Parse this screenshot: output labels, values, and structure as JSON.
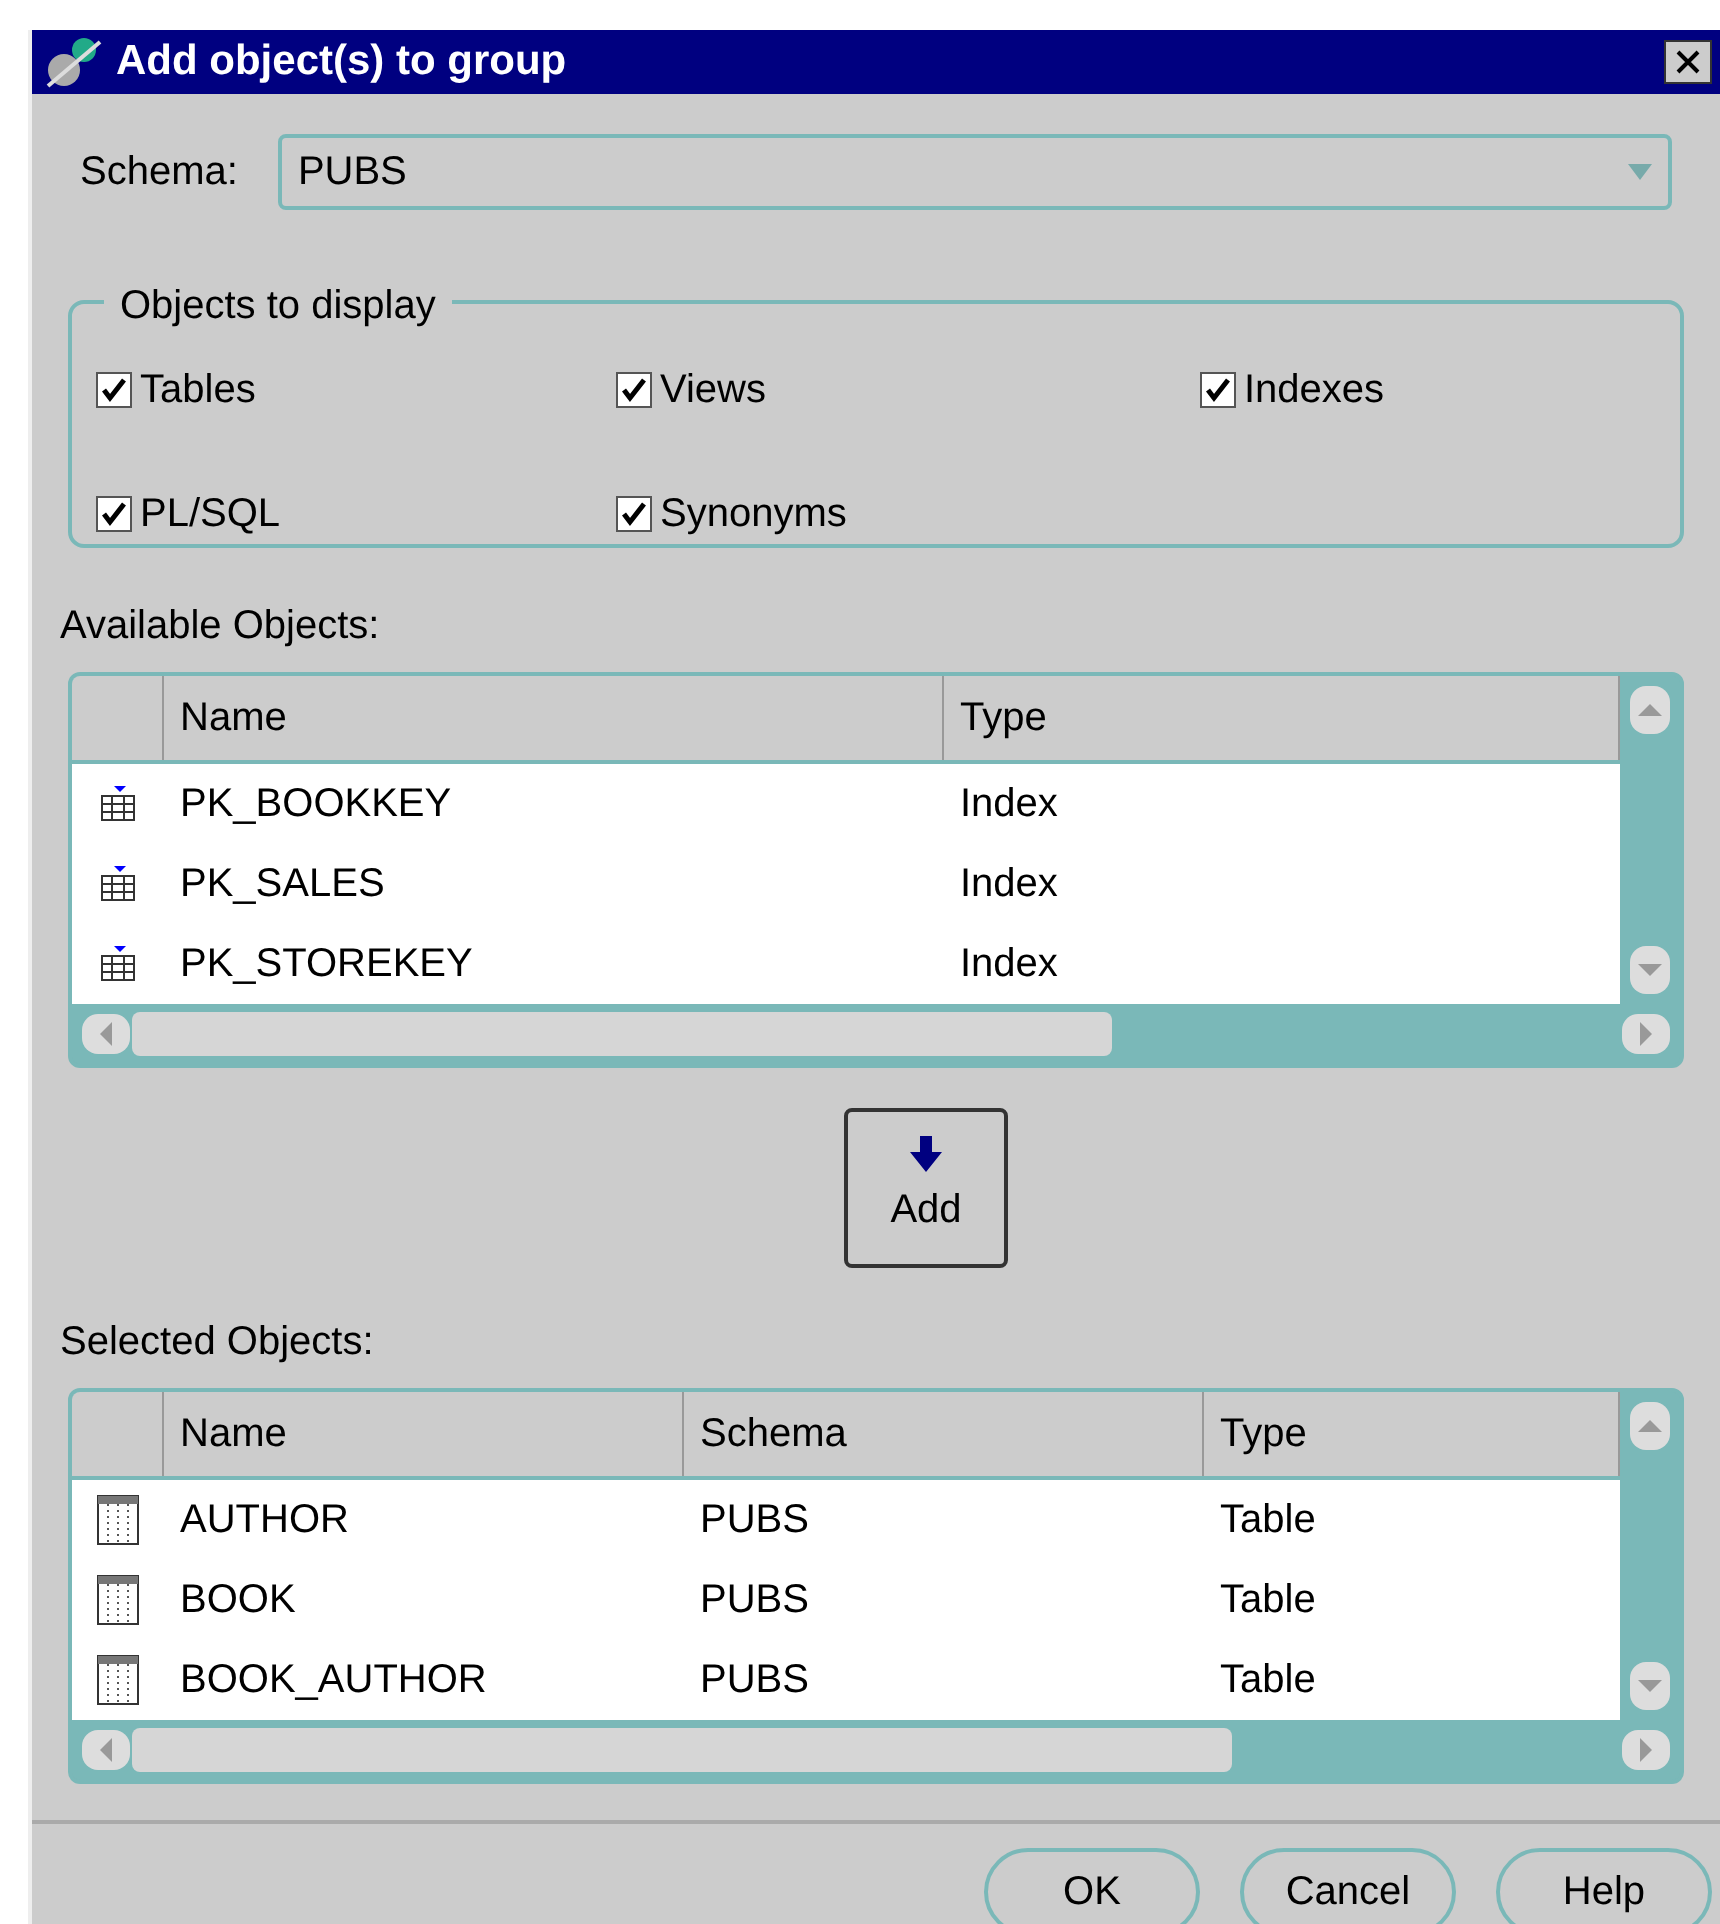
{
  "window": {
    "title": "Add object(s) to group"
  },
  "schema": {
    "label": "Schema:",
    "value": "PUBS"
  },
  "objects_to_display": {
    "title": "Objects to display",
    "options": [
      {
        "label": "Tables",
        "checked": true
      },
      {
        "label": "Views",
        "checked": true
      },
      {
        "label": "Indexes",
        "checked": true
      },
      {
        "label": "PL/SQL",
        "checked": true
      },
      {
        "label": "Synonyms",
        "checked": true
      }
    ]
  },
  "available": {
    "label": "Available Objects:",
    "columns": [
      "Name",
      "Type"
    ],
    "rows": [
      {
        "kind": "index",
        "cells": [
          "PK_BOOKKEY",
          "Index"
        ]
      },
      {
        "kind": "index",
        "cells": [
          "PK_SALES",
          "Index"
        ]
      },
      {
        "kind": "index",
        "cells": [
          "PK_STOREKEY",
          "Index"
        ]
      }
    ]
  },
  "add_button": {
    "label": "Add"
  },
  "selected": {
    "label": "Selected Objects:",
    "columns": [
      "Name",
      "Schema",
      "Type"
    ],
    "rows": [
      {
        "kind": "table",
        "cells": [
          "AUTHOR",
          "PUBS",
          "Table"
        ]
      },
      {
        "kind": "table",
        "cells": [
          "BOOK",
          "PUBS",
          "Table"
        ]
      },
      {
        "kind": "table",
        "cells": [
          "BOOK_AUTHOR",
          "PUBS",
          "Table"
        ]
      }
    ]
  },
  "buttons": [
    "OK",
    "Cancel",
    "Help"
  ]
}
